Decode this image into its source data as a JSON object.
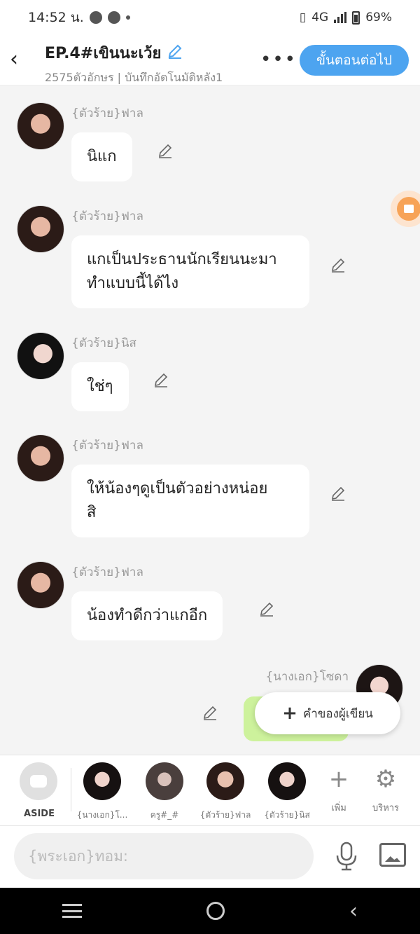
{
  "status_bar": {
    "time": "14:52 น.",
    "network": "4G",
    "battery": "69%"
  },
  "header": {
    "title": "EP.4#เขินนะเว้ย",
    "subtitle": "2575ตัวอักษร | บันทึกอัตโนมัติหลัง1",
    "more_label": "•••",
    "next_button": "ขั้นตอนต่อไป"
  },
  "messages": [
    {
      "name": "{ตัวร้าย}ฟาล",
      "text": "นิแก"
    },
    {
      "name": "{ตัวร้าย}ฟาล",
      "text_lines": [
        "แกเป็นประธานนักเรียนนะมา",
        "ทำแบบนี้ได้ไง"
      ]
    },
    {
      "name": "{ตัวร้าย}นิส",
      "text": "ใช่ๆ"
    },
    {
      "name": "{ตัวร้าย}ฟาล",
      "text_lines": [
        "ให้น้องๆดูเป็นตัวอย่างหน่อย",
        "สิ"
      ]
    },
    {
      "name": "{ตัวร้าย}ฟาล",
      "text": "น้องทำดีกว่าแกอีก"
    },
    {
      "name": "{นางเอก}โซดา",
      "side": "right"
    }
  ],
  "writer_button": "คำของผู้เขียน",
  "character_bar": {
    "aside_label": "ASIDE",
    "characters": [
      "{นางเอก}โ...",
      "ครู#_#",
      "{ตัวร้าย}ฟาล",
      "{ตัวร้าย}นิส"
    ],
    "add_label": "เพิ่ม",
    "manage_label": "บริหาร"
  },
  "input": {
    "placeholder": "{พระเอก}ทอม:"
  },
  "icons": [
    "back-arrow-icon",
    "pencil-icon",
    "more-icon",
    "record-icon",
    "plus-icon",
    "gear-icon",
    "mic-icon",
    "image-icon",
    "menu-icon",
    "home-icon"
  ],
  "colors": {
    "accent": "#4da4f0",
    "green_bubble": "#cdf29c",
    "record": "#f7a357"
  }
}
